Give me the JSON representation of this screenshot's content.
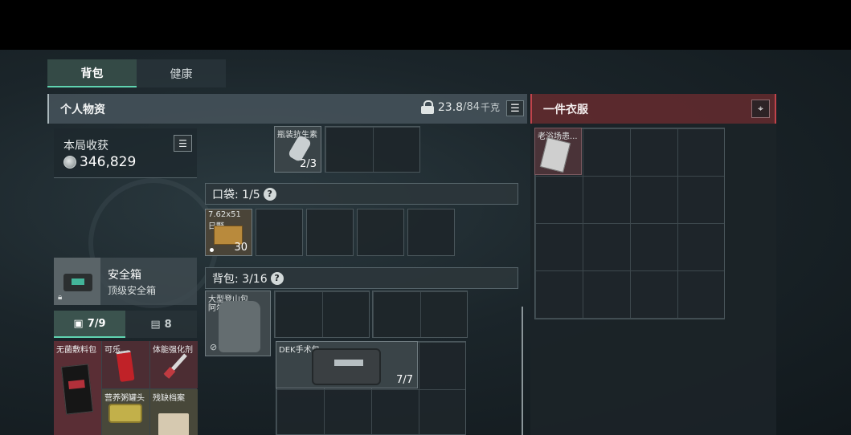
{
  "tabs": [
    {
      "label": "背包",
      "active": true
    },
    {
      "label": "健康",
      "active": false
    }
  ],
  "personal": {
    "title": "个人物资",
    "weight_current": "23.8",
    "weight_max": "/84",
    "weight_unit": "千克",
    "list_icon": "list-icon"
  },
  "clothing": {
    "title": "一件衣服",
    "pin_icon": "location-pin-icon",
    "item_label": "老浴场患..."
  },
  "haul": {
    "label": "本局收获",
    "value": "346,829"
  },
  "safe": {
    "name": "安全箱",
    "sub": "顶级安全箱"
  },
  "safe_tabs": [
    {
      "label": "7/9",
      "icon": "medkit-icon",
      "active": true
    },
    {
      "label": "8",
      "icon": "document-icon",
      "active": false
    }
  ],
  "safe_items": [
    {
      "label": "无菌敷料包"
    },
    {
      "label": "可乐"
    },
    {
      "label": "体能强化剂"
    },
    {
      "label": "营养粥罐头"
    },
    {
      "label": "残缺档案"
    }
  ],
  "top_row": {
    "item_label": "瓶装抗生素",
    "item_count": "2/3"
  },
  "pocket": {
    "label": "口袋: 1/5",
    "help": "?",
    "item_label": "7.62x51",
    "item_label2": "日野",
    "item_count": "30"
  },
  "backpack": {
    "label": "背包: 3/16",
    "help": "?",
    "bag_label": "大型登山包",
    "bag_label2": "阿尔",
    "kit_label": "DEK手术包",
    "kit_count": "7/7"
  }
}
